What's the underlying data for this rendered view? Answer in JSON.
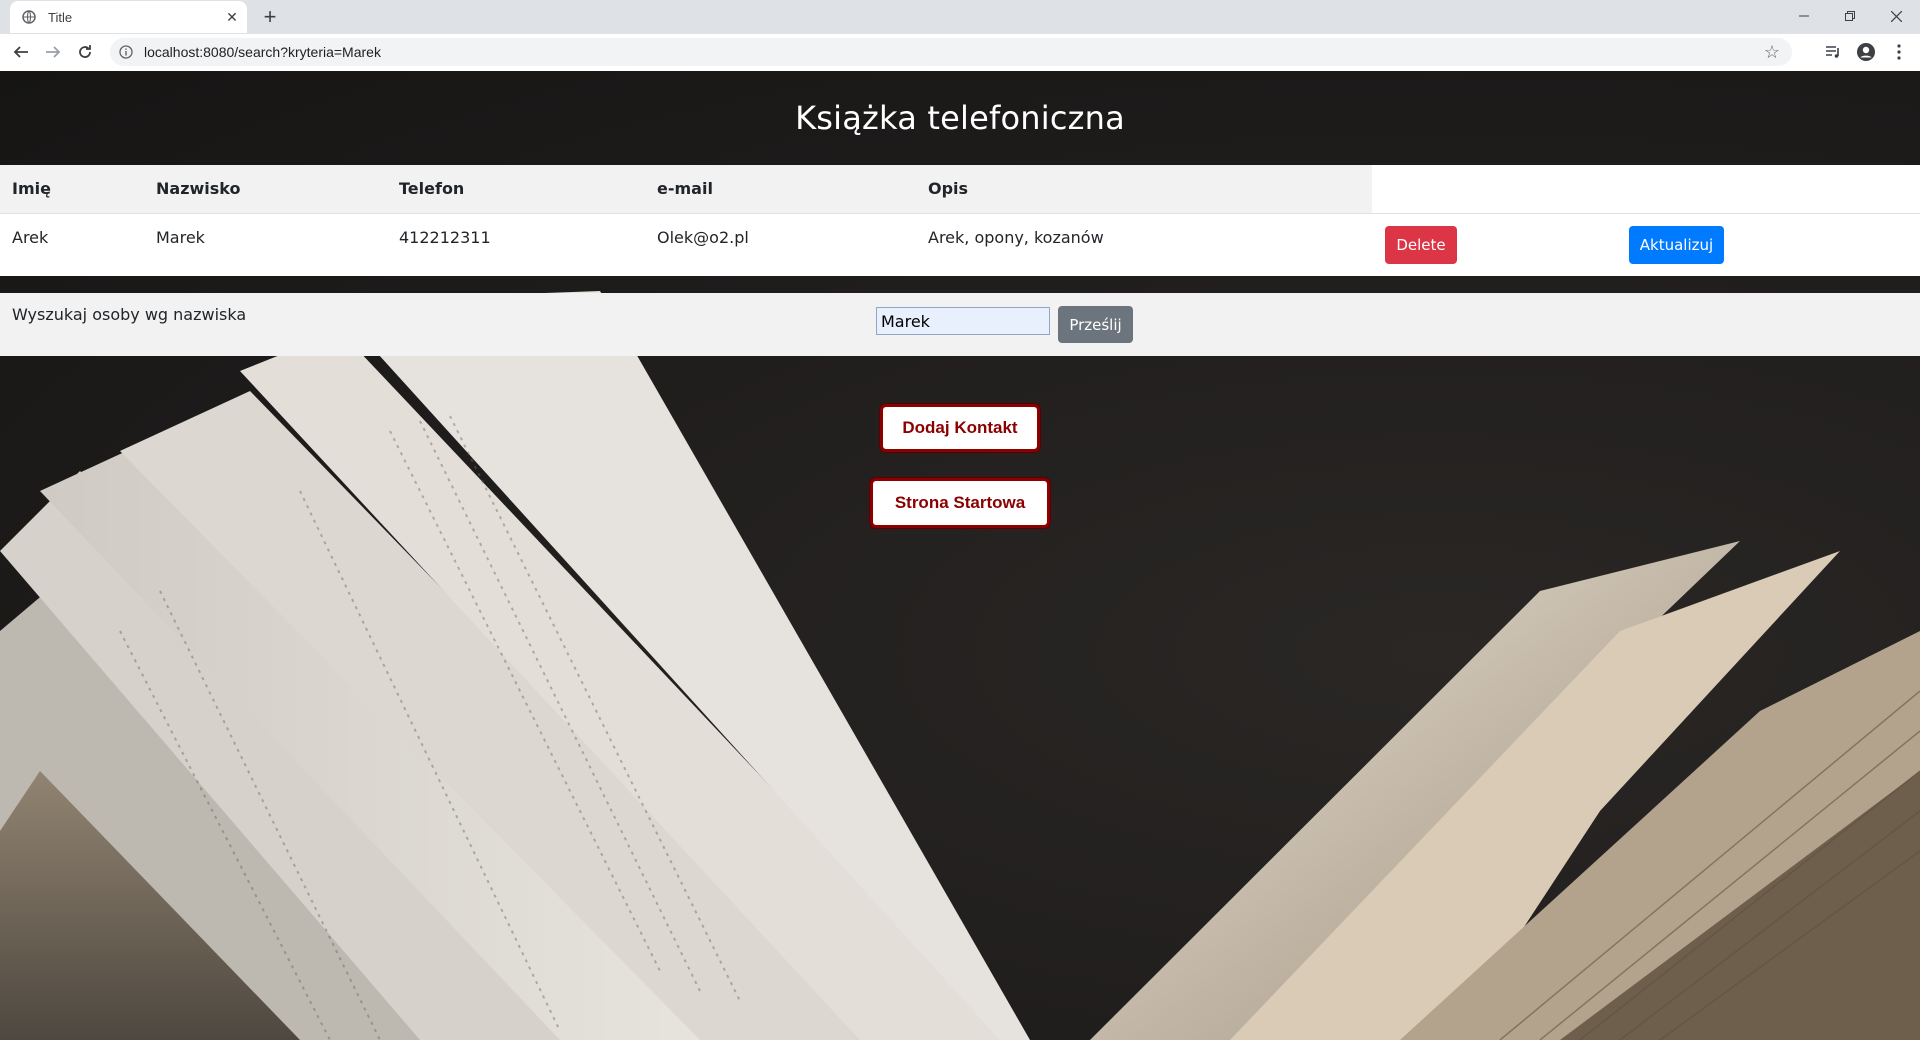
{
  "browser": {
    "tab_title": "Title",
    "url": "localhost:8080/search?kryteria=Marek"
  },
  "page": {
    "title": "Książka telefoniczna"
  },
  "table": {
    "headers": [
      "Imię",
      "Nazwisko",
      "Telefon",
      "e-mail",
      "Opis"
    ],
    "rows": [
      {
        "imie": "Arek",
        "nazwisko": "Marek",
        "telefon": "412212311",
        "email": "Olek@o2.pl",
        "opis": "Arek, opony, kozanów",
        "delete_label": "Delete",
        "update_label": "Aktualizuj"
      }
    ]
  },
  "search": {
    "label": "Wyszukaj osoby wg nazwiska",
    "value": "Marek",
    "submit_label": "Prześlij"
  },
  "actions": {
    "add_contact_label": "Dodaj Kontakt",
    "home_label": "Strona Startowa"
  },
  "colors": {
    "danger": "#dc3545",
    "primary": "#007bff",
    "secondary": "#6c757d",
    "accent_dark_red": "#8b0000"
  }
}
